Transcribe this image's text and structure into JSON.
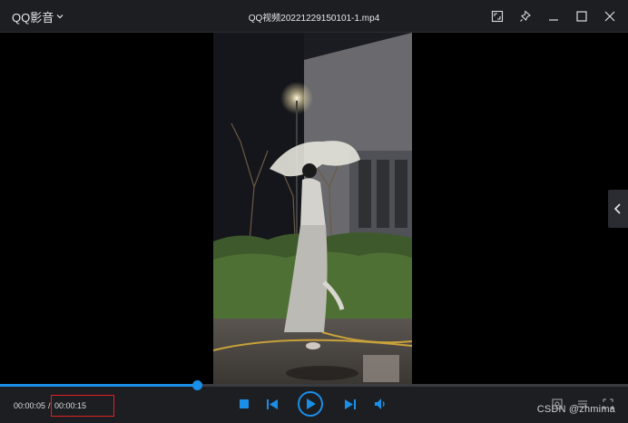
{
  "app": {
    "menu_label": "QQ影音",
    "file_title": "QQ视频20221229150101-1.mp4"
  },
  "titlebar_icons": [
    "screenshot-icon",
    "pin-icon",
    "minimize-icon",
    "maximize-icon",
    "close-icon"
  ],
  "player": {
    "current_time": "00:00:05",
    "separator": "/",
    "total_time": "00:00:15",
    "progress_fraction": 0.314
  },
  "controls": [
    "stop-icon",
    "previous-icon",
    "play-icon",
    "next-icon",
    "volume-icon"
  ],
  "overlay": {
    "watermark": "CSDN @zhmima",
    "highlight_color": "#e02020"
  },
  "colors": {
    "accent": "#1a8fe8",
    "bar_bg": "#1d1e22"
  }
}
